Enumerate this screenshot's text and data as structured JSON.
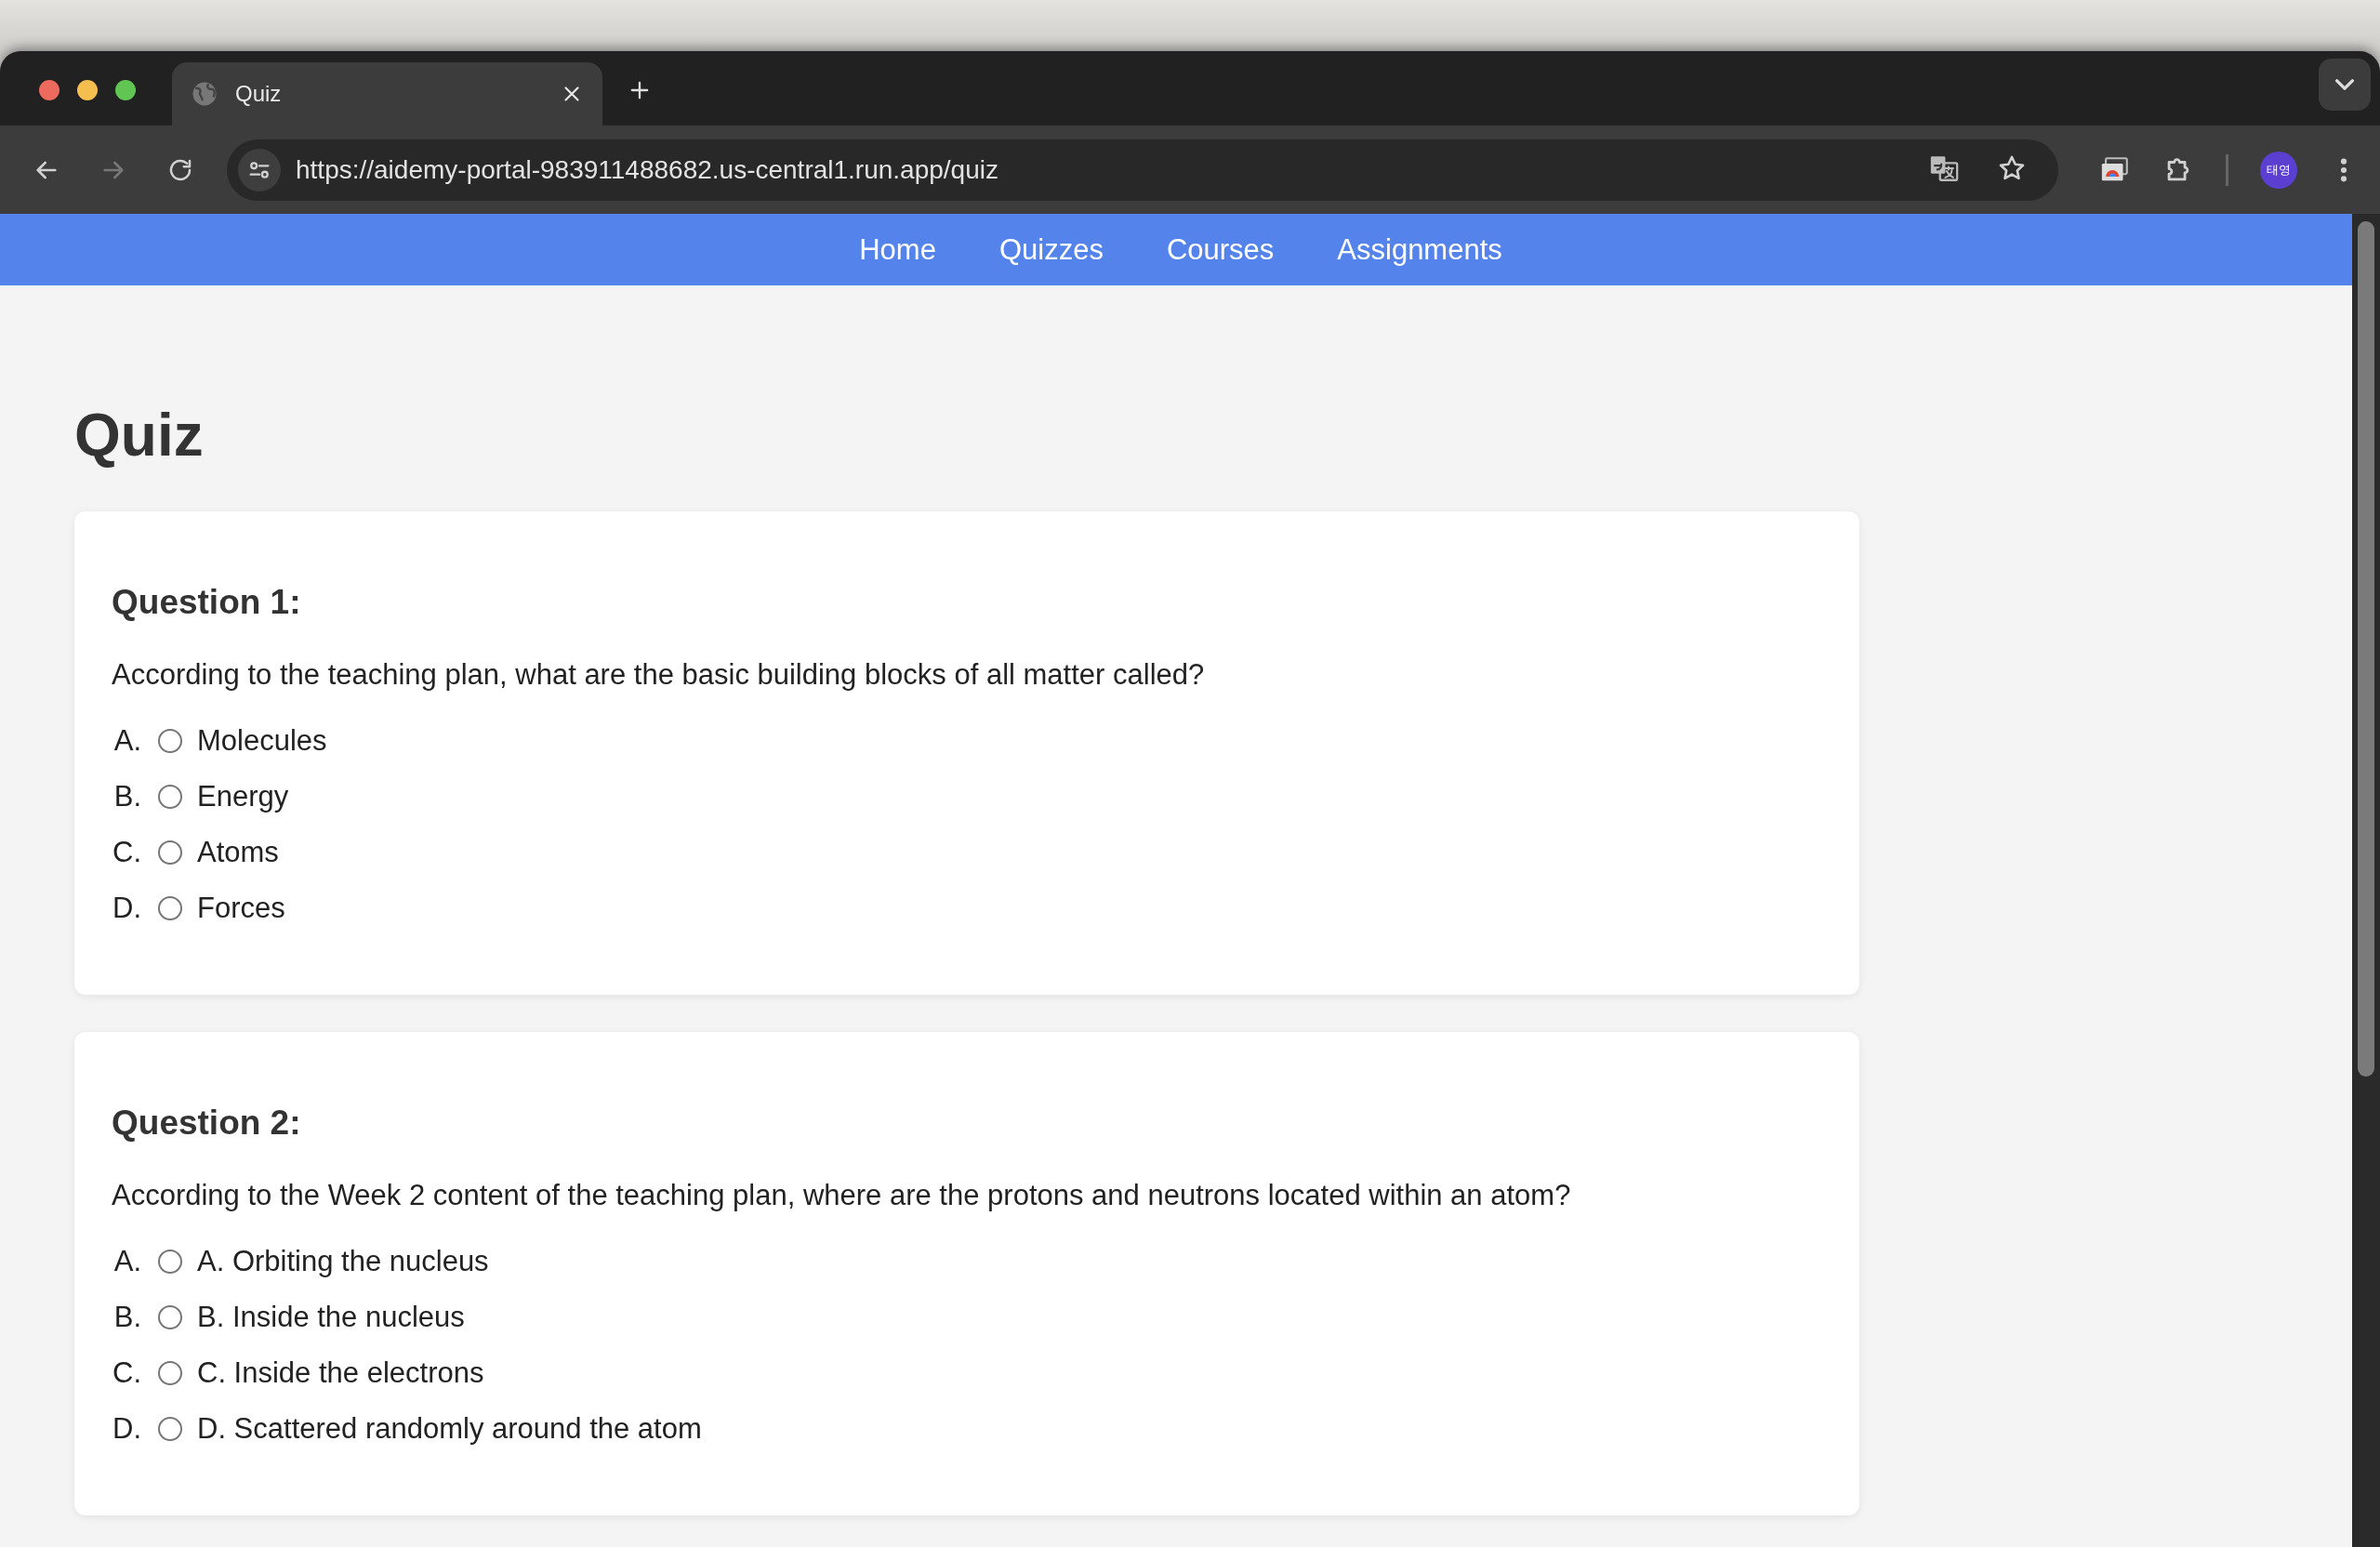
{
  "browser": {
    "tab": {
      "title": "Quiz"
    },
    "forward_disabled": true,
    "url": "https://aidemy-portal-983911488682.us-central1.run.app/quiz",
    "profile": {
      "initials": "태영"
    }
  },
  "nav": {
    "links": [
      {
        "label": "Home"
      },
      {
        "label": "Quizzes"
      },
      {
        "label": "Courses"
      },
      {
        "label": "Assignments"
      }
    ]
  },
  "page": {
    "title": "Quiz"
  },
  "questions": [
    {
      "heading": "Question 1:",
      "text": "According to the teaching plan, what are the basic building blocks of all matter called?",
      "options": [
        {
          "marker": "A.",
          "label": "Molecules",
          "selected": false
        },
        {
          "marker": "B.",
          "label": "Energy",
          "selected": false
        },
        {
          "marker": "C.",
          "label": "Atoms",
          "selected": false
        },
        {
          "marker": "D.",
          "label": "Forces",
          "selected": false
        }
      ]
    },
    {
      "heading": "Question 2:",
      "text": "According to the Week 2 content of the teaching plan, where are the protons and neutrons located within an atom?",
      "options": [
        {
          "marker": "A.",
          "label": "A. Orbiting the nucleus",
          "selected": false
        },
        {
          "marker": "B.",
          "label": "B. Inside the nucleus",
          "selected": false
        },
        {
          "marker": "C.",
          "label": "C. Inside the electrons",
          "selected": false
        },
        {
          "marker": "D.",
          "label": "D. Scattered randomly around the atom",
          "selected": false
        }
      ]
    }
  ]
}
